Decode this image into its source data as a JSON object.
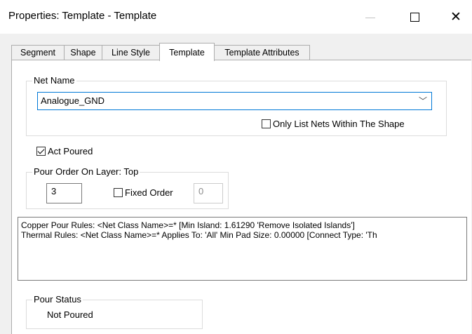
{
  "window": {
    "title": "Properties: Template - Template",
    "minimize_glyph": "—",
    "close_glyph": "✕"
  },
  "tabs": [
    {
      "label": "Segment"
    },
    {
      "label": "Shape"
    },
    {
      "label": "Line Style"
    },
    {
      "label": "Template"
    },
    {
      "label": "Template Attributes"
    }
  ],
  "active_tab": "Template",
  "net_name": {
    "group_label": "Net Name",
    "value": "Analogue_GND",
    "dropdown_glyph": "﹀",
    "only_list_label": "Only List Nets Within The Shape",
    "only_list_checked": false
  },
  "act_poured": {
    "label": "Act Poured",
    "checked": true
  },
  "pour_order": {
    "group_label": "Pour Order On Layer: Top",
    "order_value": "3",
    "fixed_order_label": "Fixed Order",
    "fixed_order_checked": false,
    "fixed_value": "0"
  },
  "rules": {
    "line1": "Copper Pour Rules: <Net Class Name>=*  [Min Island: 1.61290 'Remove Isolated Islands']",
    "line2": "Thermal Rules: <Net Class Name>=* Applies To: 'All' Min Pad Size: 0.00000  [Connect Type: 'Th"
  },
  "pour_status": {
    "group_label": "Pour Status",
    "value": "Not Poured"
  }
}
